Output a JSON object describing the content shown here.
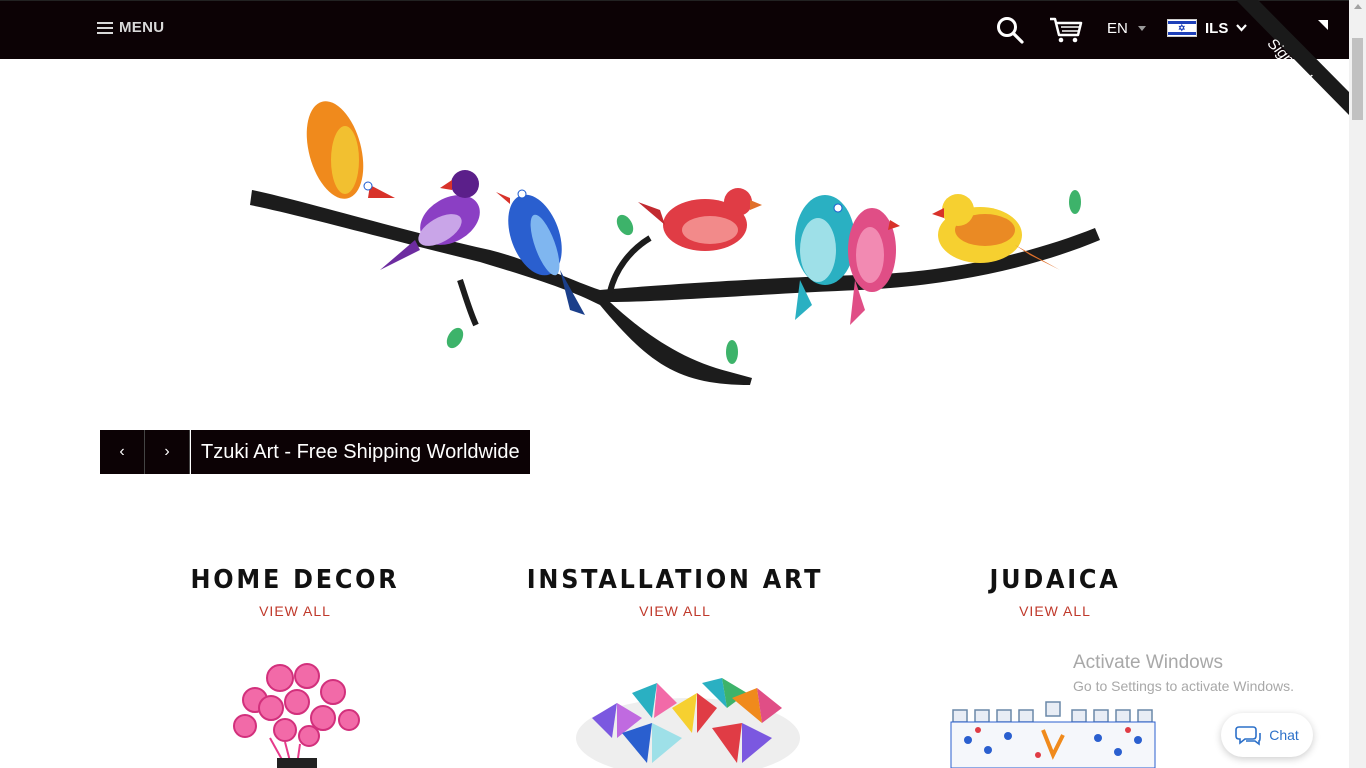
{
  "header": {
    "menu_label": "MENU",
    "language": "EN",
    "currency": "ILS",
    "signup_label": "Sign up!",
    "icons": [
      "hamburger-icon",
      "search-icon",
      "cart-icon",
      "israel-flag-icon",
      "chevron-down-icon"
    ]
  },
  "hero": {
    "caption": "Tzuki Art - Free Shipping Worldwide",
    "prev_symbol": "‹",
    "next_symbol": "›"
  },
  "collections": [
    {
      "title": "HOME DECOR",
      "link": "VIEW ALL"
    },
    {
      "title": "INSTALLATION ART",
      "link": "VIEW ALL"
    },
    {
      "title": "JUDAICA",
      "link": "VIEW ALL"
    }
  ],
  "windows_notice": {
    "title": "Activate Windows",
    "subtitle": "Go to Settings to activate Windows."
  },
  "chat": {
    "label": "Chat"
  },
  "colors": {
    "topbar": "#0c0205",
    "link_red": "#c0392b",
    "chat_blue": "#2c70c9"
  }
}
